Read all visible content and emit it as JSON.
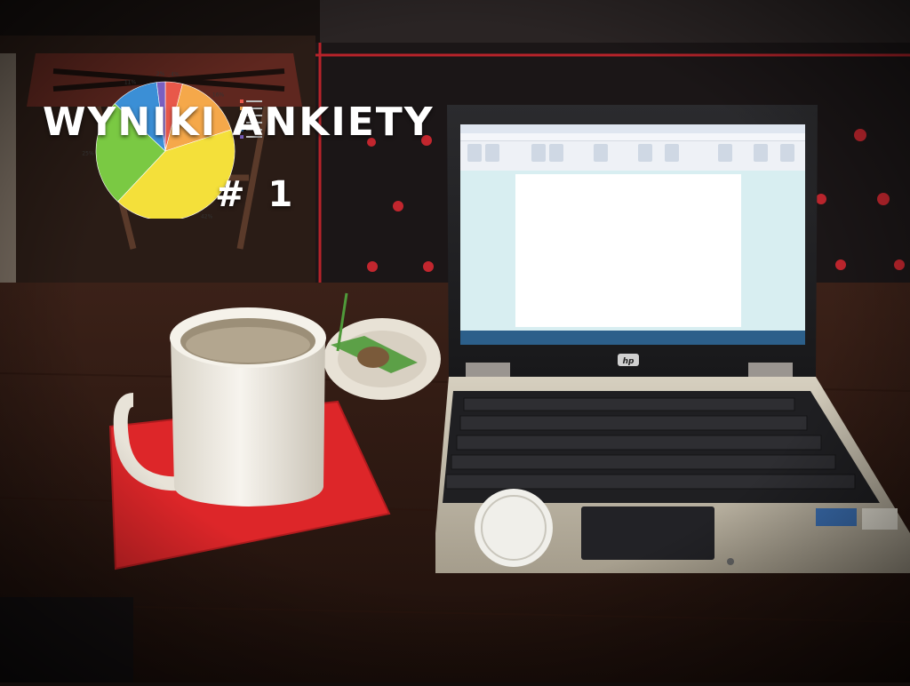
{
  "overlay": {
    "title": "WYNIKI ANKIETY",
    "subtitle": "# 1"
  },
  "laptop_screen": {
    "brand": "hp",
    "chart_data": {
      "type": "pie",
      "slices": [
        {
          "label": "4%",
          "value": 4,
          "color": "#e8584a"
        },
        {
          "label": "16%",
          "value": 16,
          "color": "#f5a84a"
        },
        {
          "label": "42%",
          "value": 42,
          "color": "#f4e03a"
        },
        {
          "label": "25%",
          "value": 25,
          "color": "#7ac943"
        },
        {
          "label": "11%",
          "value": 11,
          "color": "#3b8fd6"
        },
        {
          "label": "2%",
          "value": 2,
          "color": "#7a5fc0"
        }
      ]
    }
  },
  "colors": {
    "background": "#120d0b",
    "table": "#3a1f17",
    "napkin": "#e0282a",
    "mug": "#f3f0e8",
    "laptop_body": "#c9c2b2",
    "keyboard": "#2a2a2c"
  }
}
